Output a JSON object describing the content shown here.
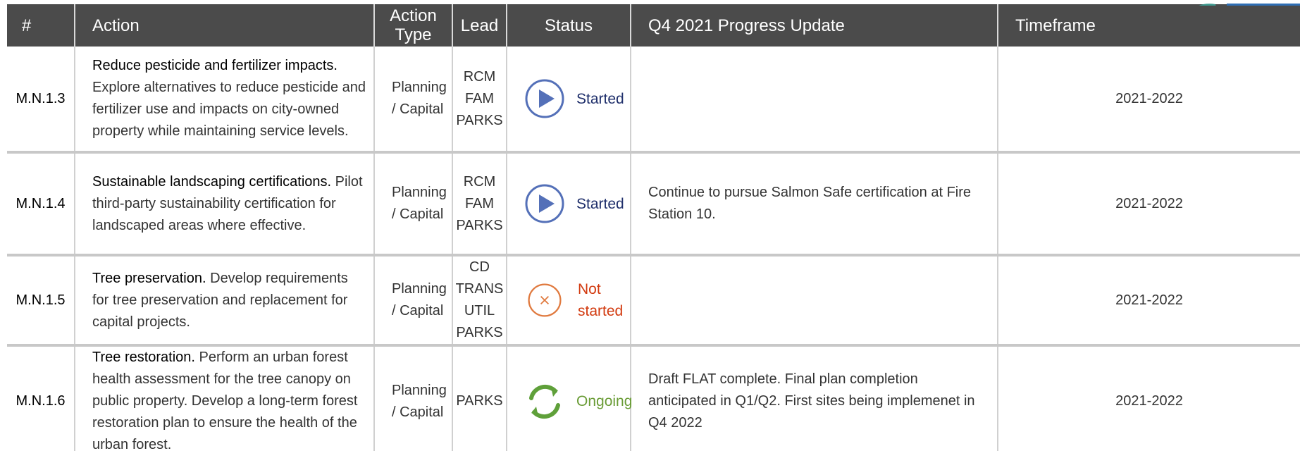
{
  "colors": {
    "header_bg": "#4b4b4b",
    "started_icon": "#5470b8",
    "not_started_icon": "#e07a3f",
    "ongoing_icon": "#5fa03a",
    "logo_blue": "#2f6fb5",
    "logo_teal": "#3e9a8f"
  },
  "header": {
    "num": "#",
    "action": "Action",
    "type": "Action Type",
    "lead": "Lead",
    "status": "Status",
    "update": "Q4 2021 Progress Update",
    "timeframe": "Timeframe"
  },
  "rows": [
    {
      "num": "M.N.1.3",
      "title": "Reduce pesticide and fertilizer impacts.",
      "desc": " Explore alternatives to reduce pesticide and fertilizer use and impacts on city-owned property while maintaining service levels.",
      "type": "Planning / Capital",
      "leads": [
        "RCM",
        "FAM",
        "PARKS"
      ],
      "status": "Started",
      "status_icon": "play-circle-icon",
      "update": "",
      "timeframe": "2021-2022"
    },
    {
      "num": "M.N.1.4",
      "title": "Sustainable landscaping certifications.",
      "desc": " Pilot third-party sustainability certification for landscaped areas where effective.",
      "type": "Planning / Capital",
      "leads": [
        "RCM",
        "FAM",
        "PARKS"
      ],
      "status": "Started",
      "status_icon": "play-circle-icon",
      "update": "Continue to pursue Salmon Safe certification at Fire Station 10.",
      "timeframe": "2021-2022"
    },
    {
      "num": "M.N.1.5",
      "title": "Tree preservation.",
      "desc": " Develop requirements for tree preservation and replacement for capital projects.",
      "type": "Planning / Capital",
      "leads": [
        "CD",
        "TRANS",
        "UTIL",
        "PARKS"
      ],
      "status": "Not started",
      "status_icon": "x-circle-icon",
      "update": "",
      "timeframe": "2021-2022"
    },
    {
      "num": "M.N.1.6",
      "title": "Tree restoration.",
      "desc": " Perform an urban forest health assessment for the tree canopy on public property. Develop a long-term forest restoration plan to ensure the health of the urban forest.",
      "type": "Planning / Capital",
      "leads": [
        "PARKS"
      ],
      "status": "Ongoing",
      "status_icon": "cycle-arrows-icon",
      "update": "Draft FLAT complete.  Final plan completion anticipated in Q1/Q2.  First sites being implemenet in Q4 2022",
      "timeframe": "2021-2022"
    }
  ]
}
